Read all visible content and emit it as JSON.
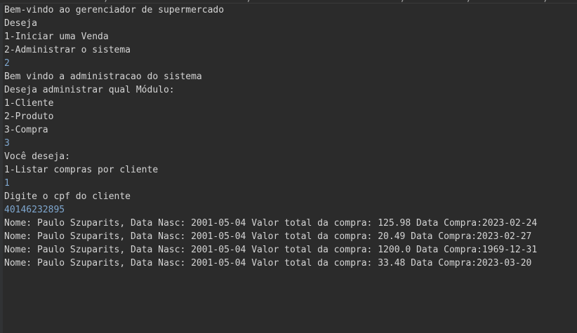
{
  "window": {
    "top_strip_text": "                  ,                         ,                           ,           ,             ,           ,             ,                  ,        ,                    ,"
  },
  "colors": {
    "background": "#2b2b2b",
    "output_text": "#d4d4d4",
    "user_input_text": "#7fa7cf"
  },
  "console": {
    "lines": [
      {
        "text": "Bem-vindo ao gerenciador de supermercado",
        "kind": "output"
      },
      {
        "text": "Deseja",
        "kind": "output"
      },
      {
        "text": "1-Iniciar uma Venda",
        "kind": "output"
      },
      {
        "text": "2-Administrar o sistema",
        "kind": "output"
      },
      {
        "text": "2",
        "kind": "input"
      },
      {
        "text": "Bem vindo a administracao do sistema",
        "kind": "output"
      },
      {
        "text": "Deseja administrar qual Módulo:",
        "kind": "output"
      },
      {
        "text": "1-Cliente",
        "kind": "output"
      },
      {
        "text": "2-Produto",
        "kind": "output"
      },
      {
        "text": "3-Compra",
        "kind": "output"
      },
      {
        "text": "3",
        "kind": "input"
      },
      {
        "text": "Você deseja:",
        "kind": "output"
      },
      {
        "text": "1-Listar compras por cliente",
        "kind": "output"
      },
      {
        "text": "1",
        "kind": "input"
      },
      {
        "text": "Digite o cpf do cliente",
        "kind": "output"
      },
      {
        "text": "40146232895",
        "kind": "input"
      },
      {
        "text": "Nome: Paulo Szuparits, Data Nasc: 2001-05-04 Valor total da compra: 125.98 Data Compra:2023-02-24",
        "kind": "output"
      },
      {
        "text": "Nome: Paulo Szuparits, Data Nasc: 2001-05-04 Valor total da compra: 20.49 Data Compra:2023-02-27",
        "kind": "output"
      },
      {
        "text": "Nome: Paulo Szuparits, Data Nasc: 2001-05-04 Valor total da compra: 1200.0 Data Compra:1969-12-31",
        "kind": "output"
      },
      {
        "text": "Nome: Paulo Szuparits, Data Nasc: 2001-05-04 Valor total da compra: 33.48 Data Compra:2023-03-20",
        "kind": "output"
      }
    ]
  }
}
